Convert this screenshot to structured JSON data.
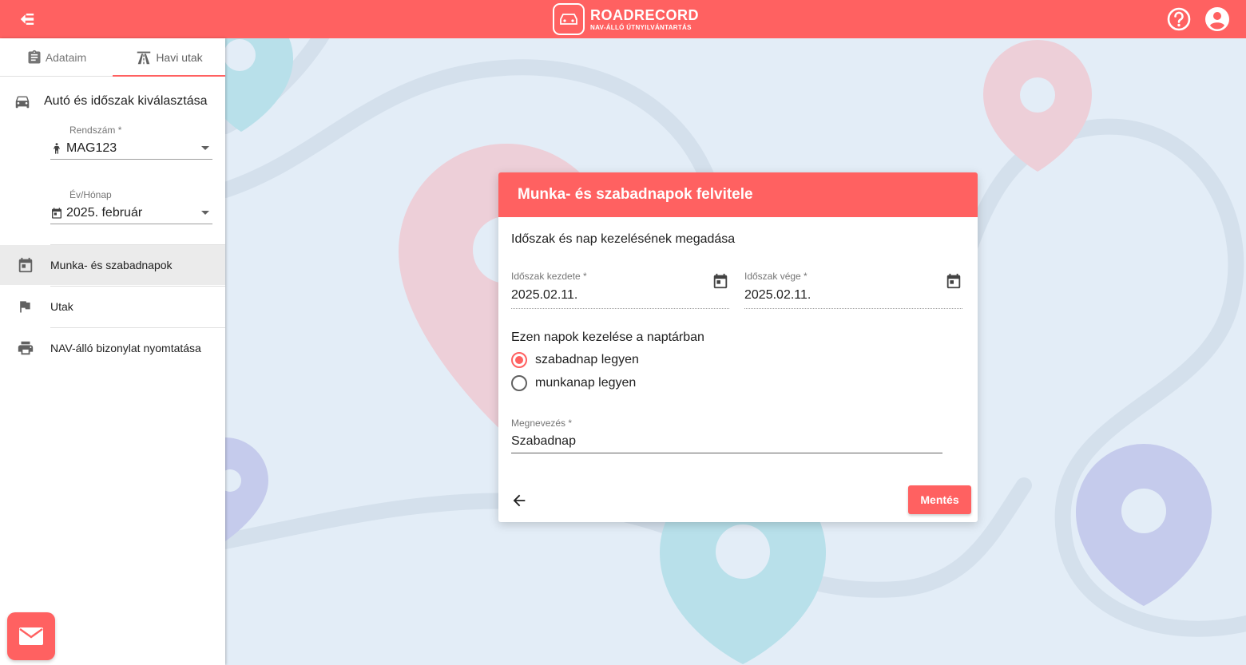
{
  "app": {
    "brand_name": "ROADRECORD",
    "brand_tagline": "NAV-ÁLLÓ ÚTNYILVÁNTARTÁS",
    "accent_color": "#ff6161"
  },
  "sidebar": {
    "tabs": [
      {
        "label": "Adataim",
        "icon": "clipboard-icon",
        "active": false
      },
      {
        "label": "Havi utak",
        "icon": "road-icon",
        "active": true
      }
    ],
    "section_title": "Autó és időszak kiválasztása",
    "plate_field": {
      "label": "Rendszám *",
      "value": "MAG123"
    },
    "month_field": {
      "label": "Év/Hónap",
      "value": "2025. február"
    },
    "menu": [
      {
        "label": "Munka- és szabadnapok",
        "icon": "calendar-icon",
        "selected": true
      },
      {
        "label": "Utak",
        "icon": "flag-icon",
        "selected": false
      },
      {
        "label": "NAV-álló bizonylat nyomtatása",
        "icon": "printer-icon",
        "selected": false
      }
    ]
  },
  "dialog": {
    "title": "Munka- és szabadnapok felvitele",
    "subtitle": "Időszak és nap kezelésének megadása",
    "start_field": {
      "label": "Időszak kezdete *",
      "value": "2025.02.11."
    },
    "end_field": {
      "label": "Időszak vége *",
      "value": "2025.02.11."
    },
    "radio_title": "Ezen napok kezelése a naptárban",
    "radio_options": [
      {
        "label": "szabadnap legyen",
        "checked": true
      },
      {
        "label": "munkanap legyen",
        "checked": false
      }
    ],
    "name_field": {
      "label": "Megnevezés *",
      "value": "Szabadnap"
    },
    "save_label": "Mentés"
  }
}
